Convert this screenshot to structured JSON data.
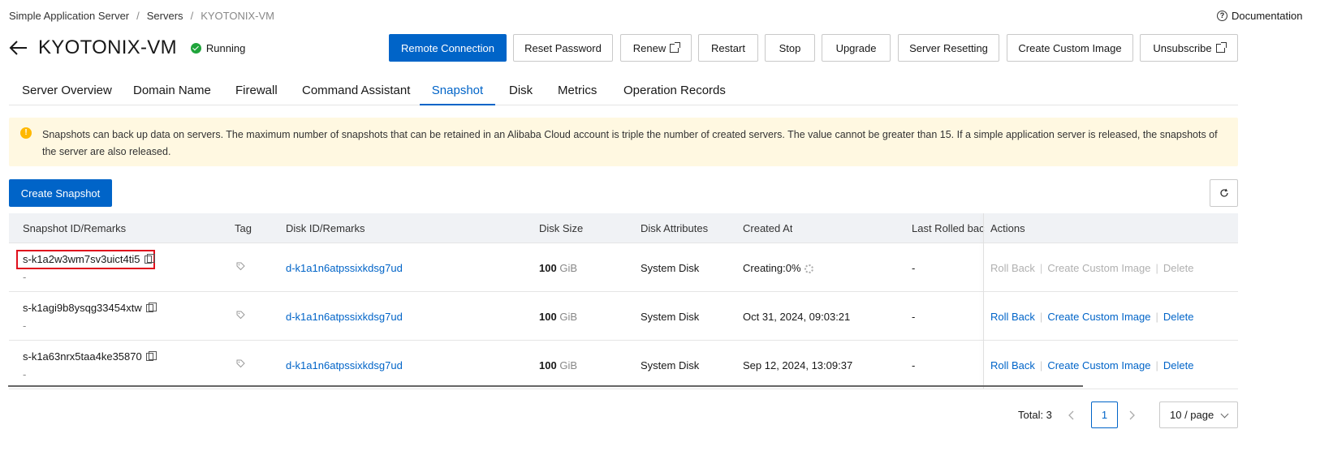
{
  "breadcrumb": [
    "Simple Application Server",
    "Servers",
    "KYOTONIX-VM"
  ],
  "documentation": "Documentation",
  "header": {
    "title": "KYOTONIX-VM",
    "status": "Running"
  },
  "toolbar": {
    "remote": "Remote Connection",
    "reset": "Reset Password",
    "renew": "Renew",
    "restart": "Restart",
    "stop": "Stop",
    "upgrade": "Upgrade",
    "resetting": "Server Resetting",
    "custom_image": "Create Custom Image",
    "unsubscribe": "Unsubscribe"
  },
  "tabs": [
    "Server Overview",
    "Domain Name",
    "Firewall",
    "Command Assistant",
    "Snapshot",
    "Disk",
    "Metrics",
    "Operation Records"
  ],
  "notice": "Snapshots can back up data on servers. The maximum number of snapshots that can be retained in an Alibaba Cloud account is triple the number of created servers. The value cannot be greater than 15. If a simple application server is released, the snapshots of the server are also released.",
  "create_snapshot": "Create Snapshot",
  "table": {
    "columns": [
      "Snapshot ID/Remarks",
      "Tag",
      "Disk ID/Remarks",
      "Disk Size",
      "Disk Attributes",
      "Created At",
      "Last Rolled back",
      "Actions"
    ],
    "rows": [
      {
        "snapshot_id": "s-k1a2w3wm7sv3uict4ti5",
        "remark": "-",
        "disk_id": "d-k1a1n6atpssixkdsg7ud",
        "size": "100",
        "unit": "GiB",
        "attr": "System Disk",
        "created": "Creating:0%",
        "rolled": "-",
        "a1": "Roll Back",
        "a2": "Create Custom Image",
        "a3": "Delete"
      },
      {
        "snapshot_id": "s-k1agi9b8ysqg33454xtw",
        "remark": "-",
        "disk_id": "d-k1a1n6atpssixkdsg7ud",
        "size": "100",
        "unit": "GiB",
        "attr": "System Disk",
        "created": "Oct 31, 2024, 09:03:21",
        "rolled": "-",
        "a1": "Roll Back",
        "a2": "Create Custom Image",
        "a3": "Delete"
      },
      {
        "snapshot_id": "s-k1a63nrx5taa4ke35870",
        "remark": "-",
        "disk_id": "d-k1a1n6atpssixkdsg7ud",
        "size": "100",
        "unit": "GiB",
        "attr": "System Disk",
        "created": "Sep 12, 2024, 13:09:37",
        "rolled": "-",
        "a1": "Roll Back",
        "a2": "Create Custom Image",
        "a3": "Delete"
      }
    ]
  },
  "pagination": {
    "total": "Total: 3",
    "page": "1",
    "size": "10 / page"
  }
}
